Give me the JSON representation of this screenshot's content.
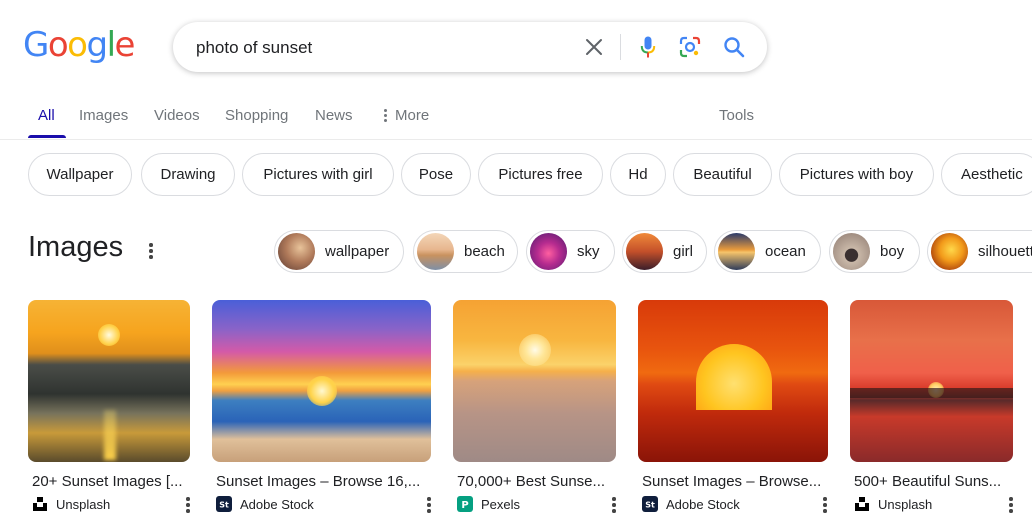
{
  "logo": {
    "letters": [
      "G",
      "o",
      "o",
      "g",
      "l",
      "e"
    ],
    "colors": [
      "#4285f4",
      "#ea4335",
      "#fbbc05",
      "#4285f4",
      "#34a853",
      "#ea4335"
    ]
  },
  "search": {
    "query": "photo of sunset"
  },
  "tabs": [
    {
      "label": "All",
      "active": true
    },
    {
      "label": "Images"
    },
    {
      "label": "Videos"
    },
    {
      "label": "Shopping"
    },
    {
      "label": "News"
    },
    {
      "label": "More"
    }
  ],
  "tools_label": "Tools",
  "chips": [
    "Wallpaper",
    "Drawing",
    "Pictures with girl",
    "Pose",
    "Pictures free",
    "Hd",
    "Beautiful",
    "Pictures with boy",
    "Aesthetic"
  ],
  "images_section": {
    "title": "Images",
    "pills": [
      "wallpaper",
      "beach",
      "sky",
      "girl",
      "ocean",
      "boy",
      "silhouette"
    ]
  },
  "results": [
    {
      "title": "20+ Sunset Images [...",
      "source": "Unsplash"
    },
    {
      "title": "Sunset Images – Browse 16,...",
      "source": "Adobe Stock"
    },
    {
      "title": "70,000+ Best Sunse...",
      "source": "Pexels"
    },
    {
      "title": "Sunset Images – Browse...",
      "source": "Adobe Stock"
    },
    {
      "title": "500+ Beautiful Suns...",
      "source": "Unsplash"
    }
  ],
  "colors": {
    "link_blue": "#1a0dab",
    "muted": "#70757a",
    "border": "#dadce0"
  }
}
